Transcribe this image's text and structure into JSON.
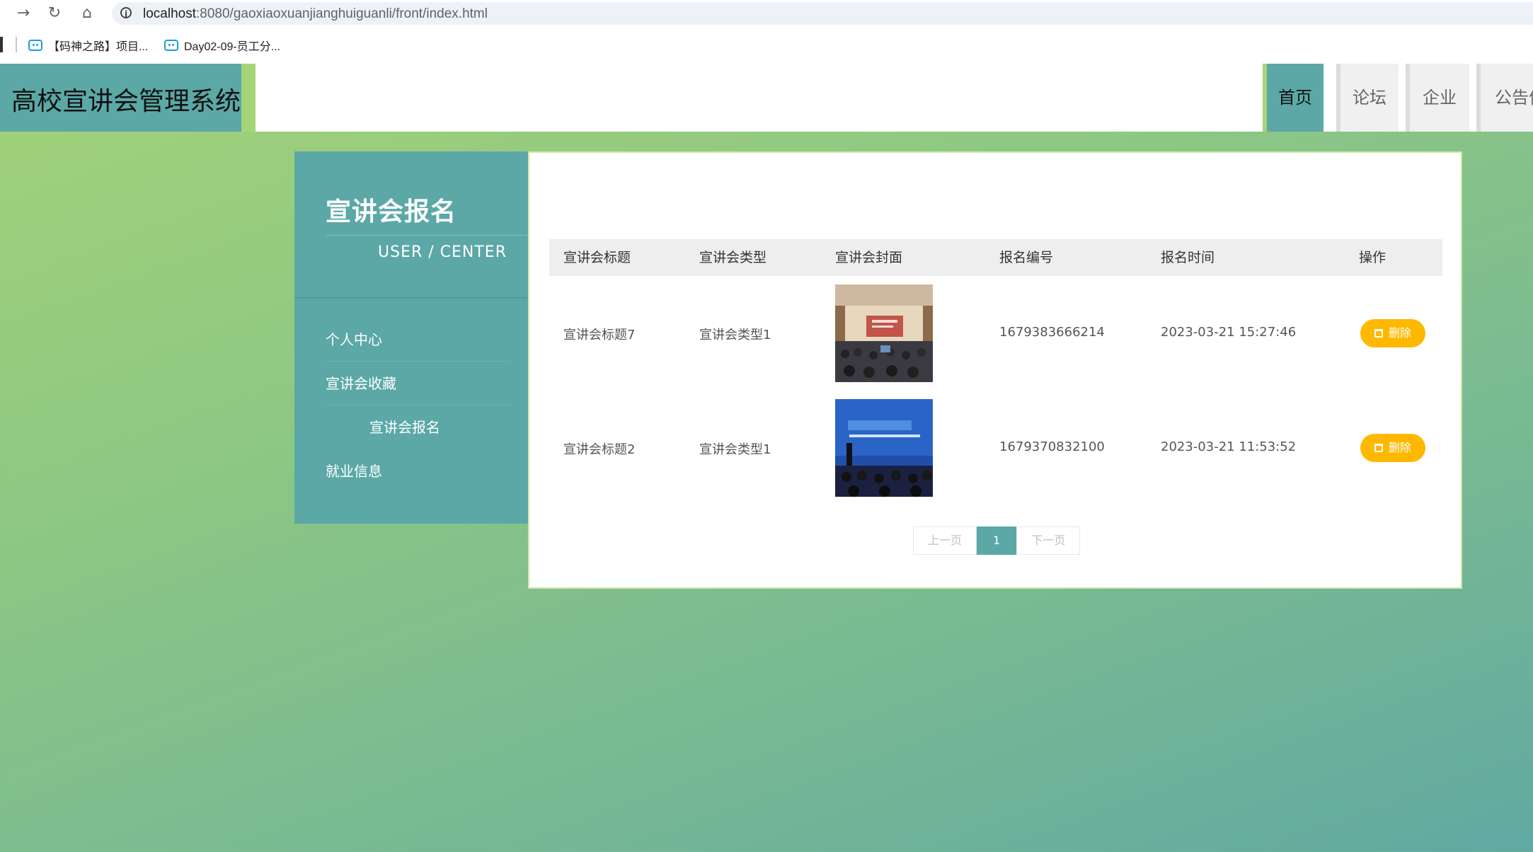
{
  "browser": {
    "url_host": "localhost",
    "url_rest": ":8080/gaoxiaoxuanjianghuiguanli/front/index.html",
    "bookmarks": [
      "【码神之路】项目...",
      "Day02-09-员工分..."
    ]
  },
  "header": {
    "site_title": "高校宣讲会管理系统",
    "nav": [
      "首页",
      "论坛",
      "企业",
      "公告信"
    ]
  },
  "sidebar": {
    "title": "宣讲会报名",
    "subtitle": "USER / CENTER",
    "items": [
      "个人中心",
      "宣讲会收藏",
      "宣讲会报名",
      "就业信息"
    ]
  },
  "table": {
    "headers": [
      "宣讲会标题",
      "宣讲会类型",
      "宣讲会封面",
      "报名编号",
      "报名时间",
      "操作"
    ],
    "rows": [
      {
        "title": "宣讲会标题7",
        "type": "宣讲会类型1",
        "number": "1679383666214",
        "time": "2023-03-21 15:27:46",
        "action": "删除"
      },
      {
        "title": "宣讲会标题2",
        "type": "宣讲会类型1",
        "number": "1679370832100",
        "time": "2023-03-21 11:53:52",
        "action": "删除"
      }
    ]
  },
  "pagination": {
    "prev": "上一页",
    "current": "1",
    "next": "下一页"
  },
  "colors": {
    "accent": "#5ba8a7",
    "delete": "#ffb800",
    "header_strip": "#a6d477"
  }
}
